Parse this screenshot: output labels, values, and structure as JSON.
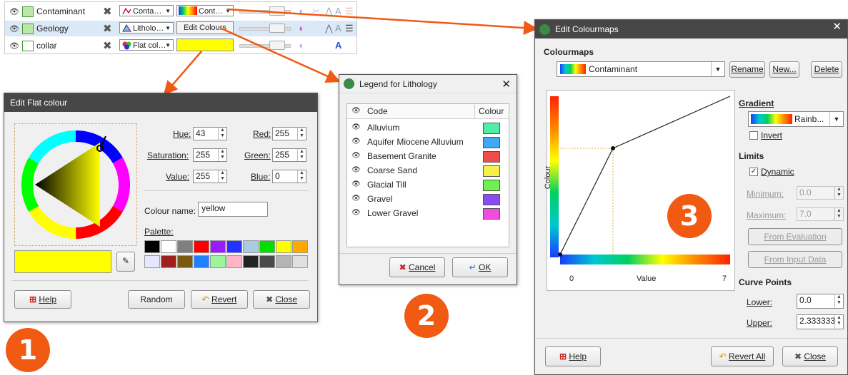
{
  "layers": [
    {
      "name": "Contaminant",
      "combo1": "Conta…",
      "combo2": "Cont…"
    },
    {
      "name": "Geology",
      "combo1": "Litholo…",
      "combo2": "Edit Colours"
    },
    {
      "name": "collar",
      "combo1": "Flat col…",
      "combo2": ""
    }
  ],
  "flat_colour": {
    "title": "Edit Flat colour",
    "hue_label": "Hue:",
    "hue": "43",
    "sat_label": "Saturation:",
    "sat": "255",
    "val_label": "Value:",
    "val": "255",
    "red_label": "Red:",
    "red": "255",
    "green_label": "Green:",
    "green": "255",
    "blue_label": "Blue:",
    "blue": "0",
    "name_label": "Colour name:",
    "name_value": "yellow",
    "palette_label": "Palette:",
    "palette": [
      "#000000",
      "#ffffff",
      "#7f7f7f",
      "#ff0000",
      "#9b1bff",
      "#2233ff",
      "#a8cce4",
      "#00e000",
      "#ffff00",
      "#ffaa00",
      "#e6e6ff",
      "#a02020",
      "#7a5a10",
      "#2080ff",
      "#9cf49c",
      "#ffb4c8",
      "#222222",
      "#4a4a4a",
      "#b4b4b4",
      "#e0e0e0"
    ],
    "current_colour": "#ffff00",
    "help": "Help",
    "random": "Random",
    "revert": "Revert",
    "close": "Close"
  },
  "legend": {
    "title": "Legend for Lithology",
    "col_code": "Code",
    "col_colour": "Colour",
    "items": [
      {
        "code": "Alluvium",
        "colour": "#4ff0a6"
      },
      {
        "code": "Aquifer Miocene Alluvium",
        "colour": "#3fa9f5"
      },
      {
        "code": "Basement Granite",
        "colour": "#f24b4b"
      },
      {
        "code": "Coarse Sand",
        "colour": "#f5f04a"
      },
      {
        "code": "Glacial Till",
        "colour": "#6ef24f"
      },
      {
        "code": "Gravel",
        "colour": "#8a4bf2"
      },
      {
        "code": "Lower Gravel",
        "colour": "#f24be0"
      }
    ],
    "cancel": "Cancel",
    "ok": "OK"
  },
  "colourmaps": {
    "title": "Edit Colourmaps",
    "section": "Colourmaps",
    "selected": "Contaminant",
    "rename": "Rename",
    "new": "New...",
    "delete": "Delete",
    "gradient_label": "Gradient",
    "gradient_value": "Rainb...",
    "invert": "Invert",
    "limits_label": "Limits",
    "dynamic": "Dynamic",
    "min_label": "Minimum:",
    "min_value": "0.0",
    "max_label": "Maximum:",
    "max_value": "7.0",
    "from_eval": "From Evaluation",
    "from_input": "From Input Data",
    "curve_label": "Curve Points",
    "lower_label": "Lower:",
    "lower_value": "0.0",
    "upper_label": "Upper:",
    "upper_value": "2.333333",
    "axis_y": "Colour",
    "axis_x": "Value",
    "x_min": "0",
    "x_max": "7",
    "help": "Help",
    "revert_all": "Revert All",
    "close": "Close"
  },
  "badges": [
    "1",
    "2",
    "3"
  ],
  "accent": "#f05a12"
}
